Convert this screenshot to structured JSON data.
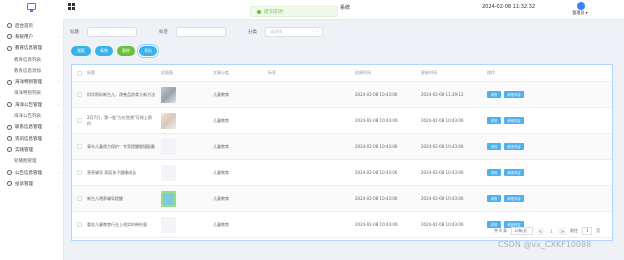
{
  "header": {
    "system_title": "系统",
    "toast_text": "提交成功!",
    "datetime": "2024-02-08 11:32:32",
    "username": "管理员 ▾"
  },
  "sidebar": {
    "items": [
      {
        "label": "后台首页",
        "icon": "home-icon",
        "sub": false,
        "chev": false
      },
      {
        "label": "系统用户",
        "icon": "user-icon",
        "sub": false,
        "chev": true
      },
      {
        "label": "教育信息管理",
        "icon": "book-icon",
        "sub": false,
        "chev": true
      },
      {
        "label": "教育信息列表",
        "icon": "",
        "sub": true,
        "chev": false
      },
      {
        "label": "教育信息添加",
        "icon": "",
        "sub": true,
        "chev": false
      },
      {
        "label": "海洋特别管理",
        "icon": "folder-icon",
        "sub": false,
        "chev": true
      },
      {
        "label": "海洋特别列表",
        "icon": "",
        "sub": true,
        "chev": false
      },
      {
        "label": "海洋公告管理",
        "icon": "notice-icon",
        "sub": false,
        "chev": true
      },
      {
        "label": "海洋公告列表",
        "icon": "",
        "sub": true,
        "chev": false
      },
      {
        "label": "联系信息管理",
        "icon": "contact-icon",
        "sub": false,
        "chev": true
      },
      {
        "label": "资讯信息管理",
        "icon": "news-icon",
        "sub": false,
        "chev": true
      },
      {
        "label": "实践管理",
        "icon": "practice-icon",
        "sub": false,
        "chev": true
      },
      {
        "label": "轮播图管理",
        "icon": "",
        "sub": true,
        "chev": false
      },
      {
        "label": "公告信息管理",
        "icon": "bell-icon",
        "sub": false,
        "chev": true
      },
      {
        "label": "投诉管理",
        "icon": "chat-icon",
        "sub": false,
        "chev": true
      }
    ]
  },
  "search": {
    "title_label": "标题",
    "tag_label": "标签",
    "category_label": "分类",
    "category_placeholder": "请选择"
  },
  "actions": {
    "search": "搜索",
    "add": "新增",
    "delete": "删除",
    "export": "导出"
  },
  "table": {
    "headers": [
      "标题",
      "封面图",
      "文章分类",
      "标签",
      "创建时间",
      "更新时间",
      "操作"
    ],
    "rows": [
      {
        "title": "科学照料新生儿，改善品质育儿新方法",
        "thumb": "t1",
        "category": "儿童教育",
        "tag": "",
        "created": "2024-02-08 10:43:06",
        "updated": "2024-02-08 11:29:12"
      },
      {
        "title": "2月7日，第一批\"九价宫颈\"可线上预约",
        "thumb": "t2",
        "category": "儿童教育",
        "tag": "",
        "created": "2024-02-08 10:43:06",
        "updated": "2024-02-08 10:43:06"
      },
      {
        "title": "青年儿童视力保护：专家提醒眼镜配戴",
        "thumb": "t3",
        "category": "儿童教育",
        "tag": "",
        "created": "2024-02-08 10:43:06",
        "updated": "2024-02-08 10:43:06"
      },
      {
        "title": "营养辅导 家庭孩子健康成长",
        "thumb": "t4",
        "category": "儿童教育",
        "tag": "",
        "created": "2024-02-08 10:43:06",
        "updated": "2024-02-08 10:43:06"
      },
      {
        "title": "新生儿喂养辅导提醒",
        "thumb": "t5",
        "category": "儿童教育",
        "tag": "",
        "created": "2024-02-08 10:43:06",
        "updated": "2024-02-08 10:43:06"
      },
      {
        "title": "重金儿童教育行业上线实时带外量",
        "thumb": "t6",
        "category": "儿童教育",
        "tag": "",
        "created": "2024-02-08 10:43:06",
        "updated": "2024-02-08 10:43:06"
      }
    ],
    "op_detail": "详情",
    "op_edit": "修改内容"
  },
  "pagination": {
    "total": "共 6 条",
    "page_size": "10条/页",
    "prev": "<",
    "current": "1",
    "next": ">",
    "goto_label": "前往",
    "goto_value": "1",
    "page_suffix": "页"
  },
  "watermark": "CSDN @vx_CXKF10088"
}
